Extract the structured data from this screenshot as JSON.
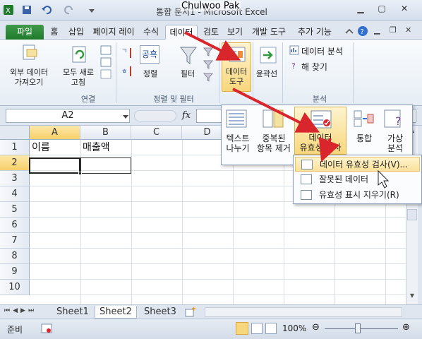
{
  "window": {
    "title": "통합 문서1 - Microsoft Excel",
    "author": "Chulwoo Pak"
  },
  "tabs": [
    {
      "label": "파일"
    },
    {
      "label": "홈"
    },
    {
      "label": "삽입"
    },
    {
      "label": "페이지 레이"
    },
    {
      "label": "수식"
    },
    {
      "label": "데이터"
    },
    {
      "label": "검토"
    },
    {
      "label": "보기"
    },
    {
      "label": "개발 도구"
    },
    {
      "label": "추가 기능"
    }
  ],
  "ribbon": {
    "external": "외부 데이터\n가져오기",
    "refresh": "모두 새로\n고침",
    "group_connection": "연결",
    "sort": "정렬",
    "filter": "필터",
    "group_sortfilter": "정렬 및 필터",
    "datatools": "데이터\n도구",
    "outline": "윤곽선",
    "data_analysis": "데이터 분석",
    "solver": "해 찾기",
    "group_analysis": "분석",
    "sort_az_label": "공흑"
  },
  "formula": {
    "namebox": "A2",
    "fx": "fx"
  },
  "grid": {
    "columns": [
      "A",
      "B",
      "C",
      "D"
    ],
    "rows": [
      "1",
      "2",
      "3",
      "4",
      "5",
      "6",
      "7",
      "8",
      "9",
      "10"
    ],
    "a1": "이름",
    "b1": "매출액"
  },
  "datatools_panel": {
    "text_to_columns": "텍스트\n나누기",
    "remove_duplicates": "중복된\n항목 제거",
    "data_validation": "데이터\n유효성 검사",
    "consolidate": "통합",
    "whatif": "가상\n분석"
  },
  "validation_menu": [
    {
      "label": "데이터 유효성 검사(V)..."
    },
    {
      "label": "잘못된 데이터"
    },
    {
      "label": "유효성 표시 지우기(R)"
    }
  ],
  "sheets": [
    "Sheet1",
    "Sheet2",
    "Sheet3"
  ],
  "status": {
    "ready": "준비",
    "zoom": "100%"
  },
  "colors": {
    "accent_green": "#1f7a2c",
    "arrow_red": "#d8262c",
    "highlight": "#f6cf6a"
  }
}
